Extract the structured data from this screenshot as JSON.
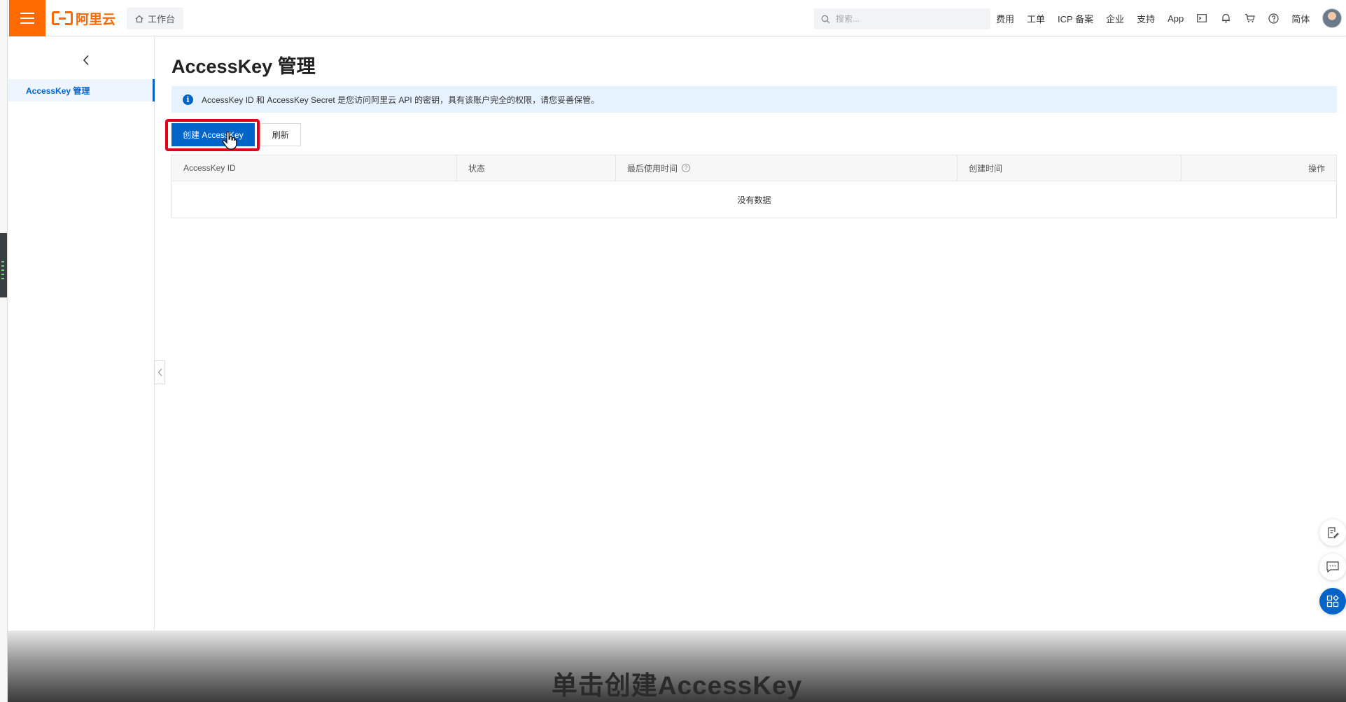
{
  "topbar": {
    "logo_text": "阿里云",
    "workbench_label": "工作台",
    "search_placeholder": "搜索...",
    "nav": [
      "费用",
      "工单",
      "ICP 备案",
      "企业",
      "支持",
      "App"
    ],
    "lang": "简体",
    "brand_color": "#ff6a00"
  },
  "sidebar": {
    "items": [
      {
        "label": "AccessKey 管理",
        "active": true
      }
    ]
  },
  "main": {
    "title": "AccessKey 管理",
    "alert": "AccessKey ID 和 AccessKey Secret 是您访问阿里云 API 的密钥，具有该账户完全的权限，请您妥善保管。",
    "create_button": "创建 AccessKey",
    "refresh_button": "刷新",
    "table": {
      "columns": [
        "AccessKey ID",
        "状态",
        "最后使用时间",
        "创建时间",
        "操作"
      ],
      "empty_text": "没有数据"
    }
  },
  "caption": "单击创建AccessKey",
  "colors": {
    "primary": "#0064c8",
    "highlight": "#e3001b",
    "alert_bg": "#e6f2ff"
  }
}
